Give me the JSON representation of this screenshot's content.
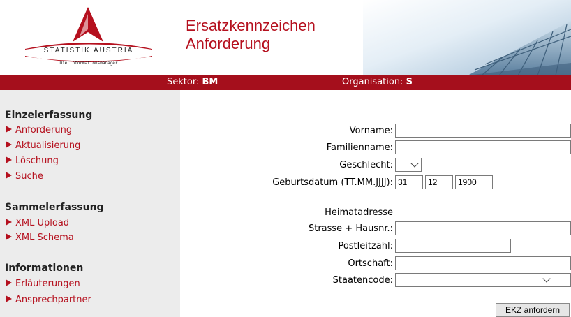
{
  "header": {
    "logo_name": "STATISTIK AUSTRIA",
    "logo_tagline": "Die Informationsmanager",
    "title_line1": "Ersatzkennzeichen",
    "title_line2": "Anforderung"
  },
  "status_bar": {
    "sektor_label": "Sektor:",
    "sektor_value": "BM",
    "organisation_label": "Organisation:",
    "organisation_value": "S"
  },
  "sidebar": {
    "sections": [
      {
        "heading": "Einzelerfassung",
        "items": [
          "Anforderung",
          "Aktualisierung",
          "Löschung",
          "Suche"
        ]
      },
      {
        "heading": "Sammelerfassung",
        "items": [
          "XML Upload",
          "XML Schema"
        ]
      },
      {
        "heading": "Informationen",
        "items": [
          "Erläuterungen",
          "Ansprechpartner"
        ]
      }
    ]
  },
  "form": {
    "vorname_label": "Vorname:",
    "vorname_value": "",
    "familienname_label": "Familienname:",
    "familienname_value": "",
    "geschlecht_label": "Geschlecht:",
    "geschlecht_value": "",
    "geburtsdatum_label": "Geburtsdatum (TT.MM.JJJJ):",
    "geburtsdatum_day": "31",
    "geburtsdatum_month": "12",
    "geburtsdatum_year": "1900",
    "heimatadresse_label": "Heimatadresse",
    "strasse_label": "Strasse + Hausnr.:",
    "strasse_value": "",
    "plz_label": "Postleitzahl:",
    "plz_value": "",
    "ortschaft_label": "Ortschaft:",
    "ortschaft_value": "",
    "staatencode_label": "Staatencode:",
    "staatencode_value": "",
    "submit_label": "EKZ anfordern"
  },
  "colors": {
    "brand_red": "#a50f1c",
    "link_red": "#b5101e",
    "sidebar_bg": "#ececec"
  }
}
